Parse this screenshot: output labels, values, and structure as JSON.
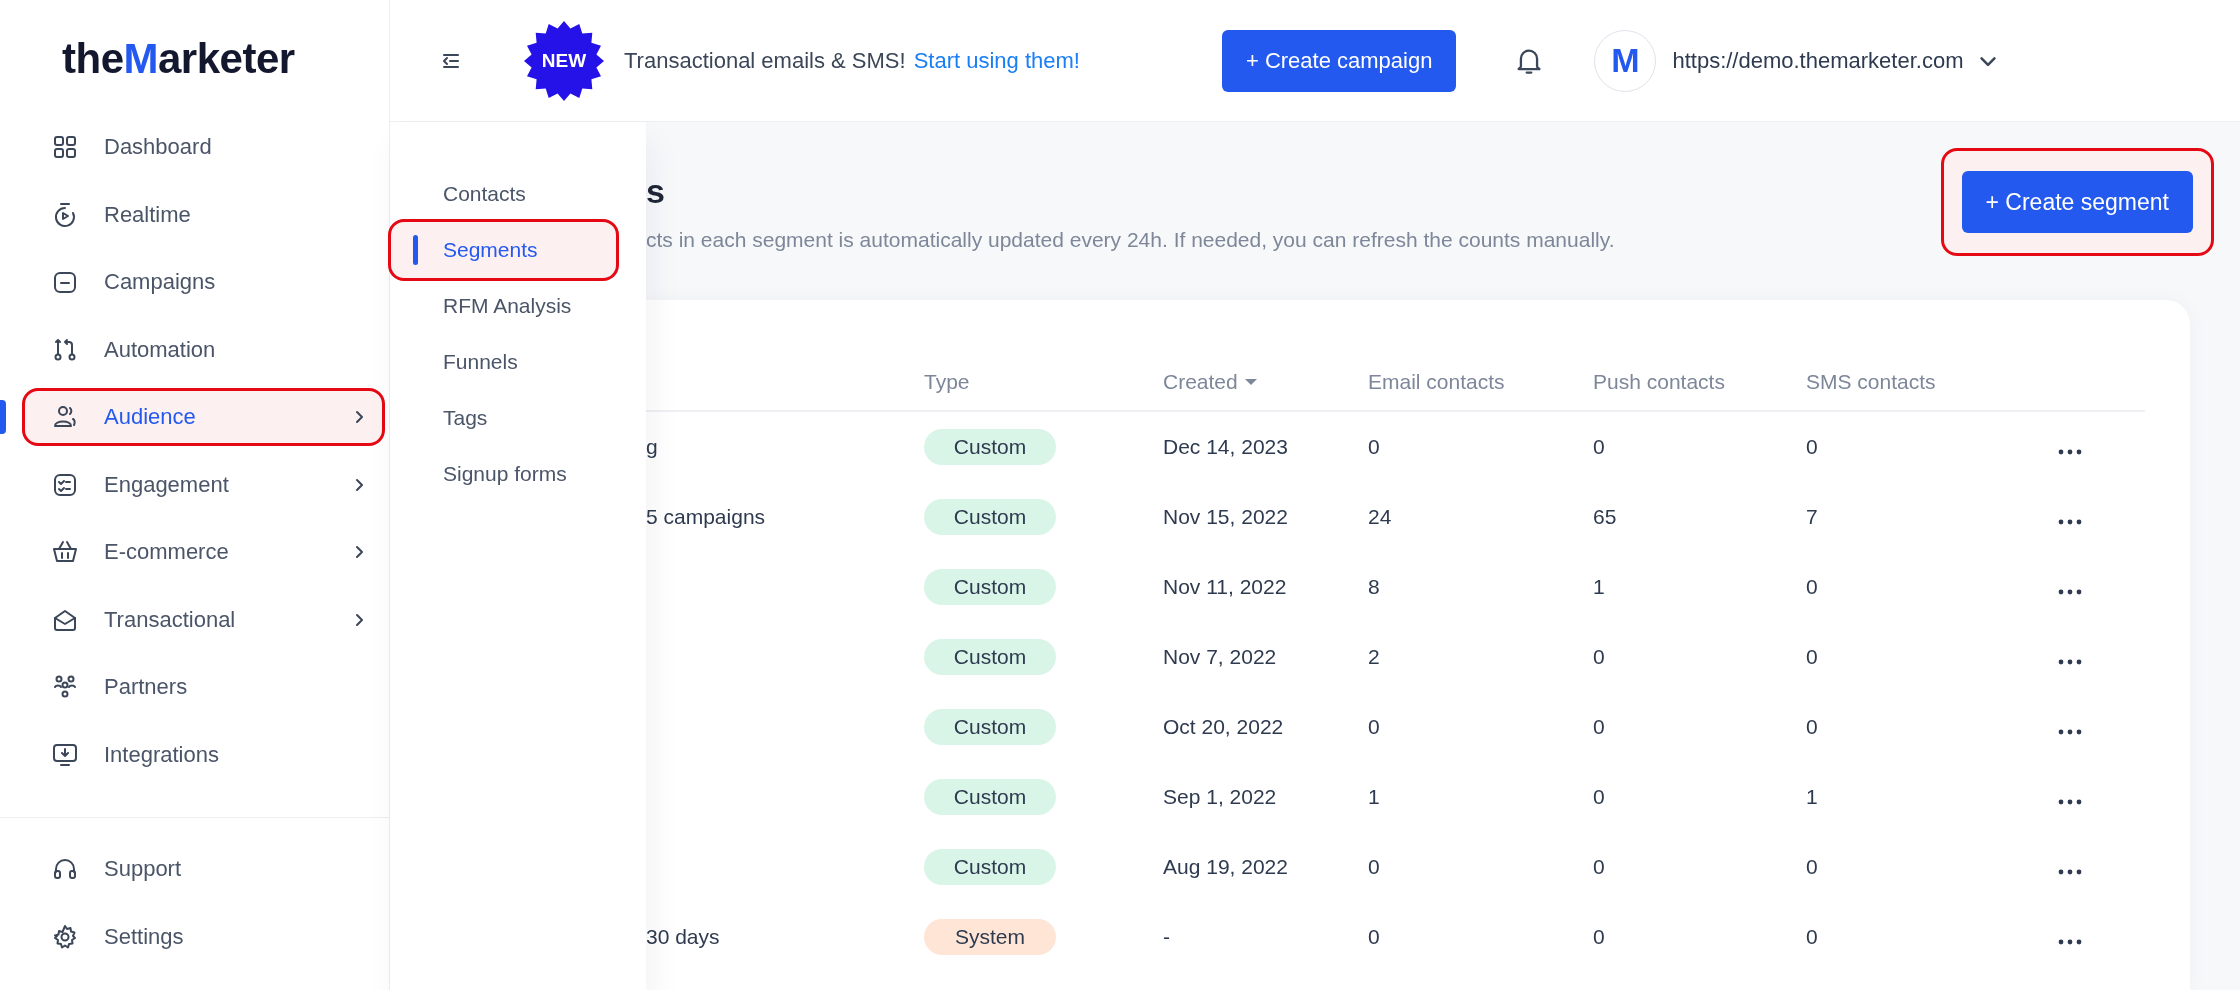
{
  "logo": {
    "before": "the",
    "mark": "M",
    "after": "arketer"
  },
  "sidebar": {
    "items": [
      {
        "label": "Dashboard",
        "selected": false,
        "has_submenu": false,
        "annotated": false
      },
      {
        "label": "Realtime",
        "selected": false,
        "has_submenu": false,
        "annotated": false
      },
      {
        "label": "Campaigns",
        "selected": false,
        "has_submenu": false,
        "annotated": false
      },
      {
        "label": "Automation",
        "selected": false,
        "has_submenu": false,
        "annotated": false
      },
      {
        "label": "Audience",
        "selected": true,
        "has_submenu": true,
        "annotated": true
      },
      {
        "label": "Engagement",
        "selected": false,
        "has_submenu": true,
        "annotated": false
      },
      {
        "label": "E-commerce",
        "selected": false,
        "has_submenu": true,
        "annotated": false
      },
      {
        "label": "Transactional",
        "selected": false,
        "has_submenu": true,
        "annotated": false
      },
      {
        "label": "Partners",
        "selected": false,
        "has_submenu": false,
        "annotated": false
      },
      {
        "label": "Integrations",
        "selected": false,
        "has_submenu": false,
        "annotated": false
      }
    ],
    "footer_items": [
      {
        "label": "Support"
      },
      {
        "label": "Settings"
      }
    ]
  },
  "topbar": {
    "badge": "NEW",
    "announcement": "Transactional emails & SMS!",
    "link": "Start using them!",
    "create_button": "+ Create campaign",
    "avatar_letter": "M",
    "account_url": "https://demo.themarketer.com"
  },
  "submenu": {
    "items": [
      {
        "label": "Contacts",
        "selected": false,
        "annotated": false
      },
      {
        "label": "Segments",
        "selected": true,
        "annotated": true
      },
      {
        "label": "RFM Analysis",
        "selected": false,
        "annotated": false
      },
      {
        "label": "Funnels",
        "selected": false,
        "annotated": false
      },
      {
        "label": "Tags",
        "selected": false,
        "annotated": false
      },
      {
        "label": "Signup forms",
        "selected": false,
        "annotated": false
      }
    ]
  },
  "page": {
    "title_fragment": "s",
    "description_fragment": "cts in each segment is automatically updated every 24h. If needed, you can refresh the counts manually.",
    "create_button": {
      "label": "+ Create segment",
      "annotated": true
    }
  },
  "table": {
    "columns": [
      {
        "label": "Type",
        "sorted": false
      },
      {
        "label": "Created",
        "sorted": true
      },
      {
        "label": "Email contacts",
        "sorted": false
      },
      {
        "label": "Push contacts",
        "sorted": false
      },
      {
        "label": "SMS contacts",
        "sorted": false
      }
    ],
    "rows": [
      {
        "name": "g",
        "type": {
          "label": "Custom",
          "kind": "custom"
        },
        "created": "Dec 14, 2023",
        "email": "0",
        "push": "0",
        "sms": "0"
      },
      {
        "name": "5 campaigns",
        "type": {
          "label": "Custom",
          "kind": "custom"
        },
        "created": "Nov 15, 2022",
        "email": "24",
        "push": "65",
        "sms": "7"
      },
      {
        "type": {
          "label": "Custom",
          "kind": "custom"
        },
        "created": "Nov 11, 2022",
        "email": "8",
        "push": "1",
        "sms": "0"
      },
      {
        "type": {
          "label": "Custom",
          "kind": "custom"
        },
        "created": "Nov 7, 2022",
        "email": "2",
        "push": "0",
        "sms": "0"
      },
      {
        "type": {
          "label": "Custom",
          "kind": "custom"
        },
        "created": "Oct 20, 2022",
        "email": "0",
        "push": "0",
        "sms": "0"
      },
      {
        "type": {
          "label": "Custom",
          "kind": "custom"
        },
        "created": "Sep 1, 2022",
        "email": "1",
        "push": "0",
        "sms": "1"
      },
      {
        "type": {
          "label": "Custom",
          "kind": "custom"
        },
        "created": "Aug 19, 2022",
        "email": "0",
        "push": "0",
        "sms": "0"
      },
      {
        "name": "30 days",
        "type": {
          "label": "System",
          "kind": "system"
        },
        "created": "-",
        "email": "0",
        "push": "0",
        "sms": "0"
      }
    ]
  }
}
